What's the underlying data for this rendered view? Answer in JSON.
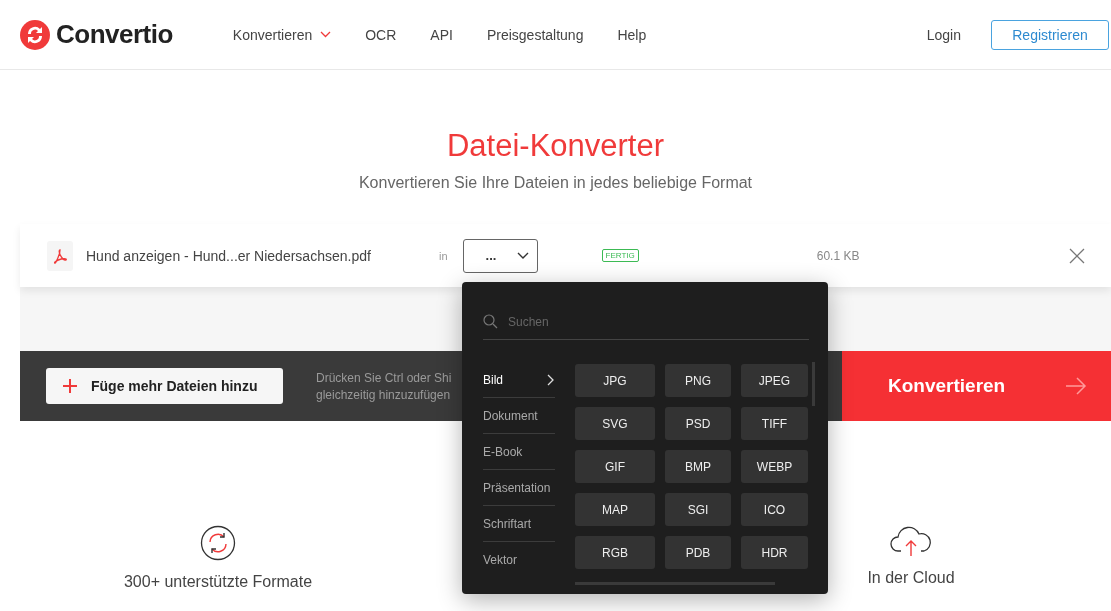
{
  "header": {
    "logo": "Convertio",
    "nav": [
      {
        "label": "Konvertieren",
        "dropdown": true
      },
      {
        "label": "OCR",
        "dropdown": false
      },
      {
        "label": "API",
        "dropdown": false
      },
      {
        "label": "Preisgestaltung",
        "dropdown": false
      },
      {
        "label": "Help",
        "dropdown": false
      }
    ],
    "login": "Login",
    "register": "Registrieren"
  },
  "hero": {
    "title": "Datei-Konverter",
    "subtitle": "Konvertieren Sie Ihre Dateien in jedes beliebige Format"
  },
  "file": {
    "name": "Hund anzeigen - Hund...er Niedersachsen.pdf",
    "in_label": "in",
    "format_value": "...",
    "status": "FERTIG",
    "size": "60.1 KB"
  },
  "actions": {
    "add_button": "Füge mehr Dateien hinzu",
    "hint_lines": [
      "Drücken Sie Ctrl oder Shi",
      "gleichzeitig hinzuzufügen"
    ],
    "convert_button": "Konvertieren"
  },
  "format_menu": {
    "search_placeholder": "Suchen",
    "categories": [
      {
        "label": "Bild",
        "selected": true
      },
      {
        "label": "Dokument",
        "selected": false
      },
      {
        "label": "E-Book",
        "selected": false
      },
      {
        "label": "Präsentation",
        "selected": false
      },
      {
        "label": "Schriftart",
        "selected": false
      },
      {
        "label": "Vektor",
        "selected": false
      }
    ],
    "formats": [
      "JPG",
      "PNG",
      "JPEG",
      "SVG",
      "PSD",
      "TIFF",
      "GIF",
      "BMP",
      "WEBP",
      "MAP",
      "SGI",
      "ICO",
      "RGB",
      "PDB",
      "HDR"
    ]
  },
  "features": [
    {
      "kind": "formats",
      "label": "300+ unterstützte Formate"
    },
    {
      "kind": "cloud",
      "label": "In der Cloud"
    }
  ]
}
